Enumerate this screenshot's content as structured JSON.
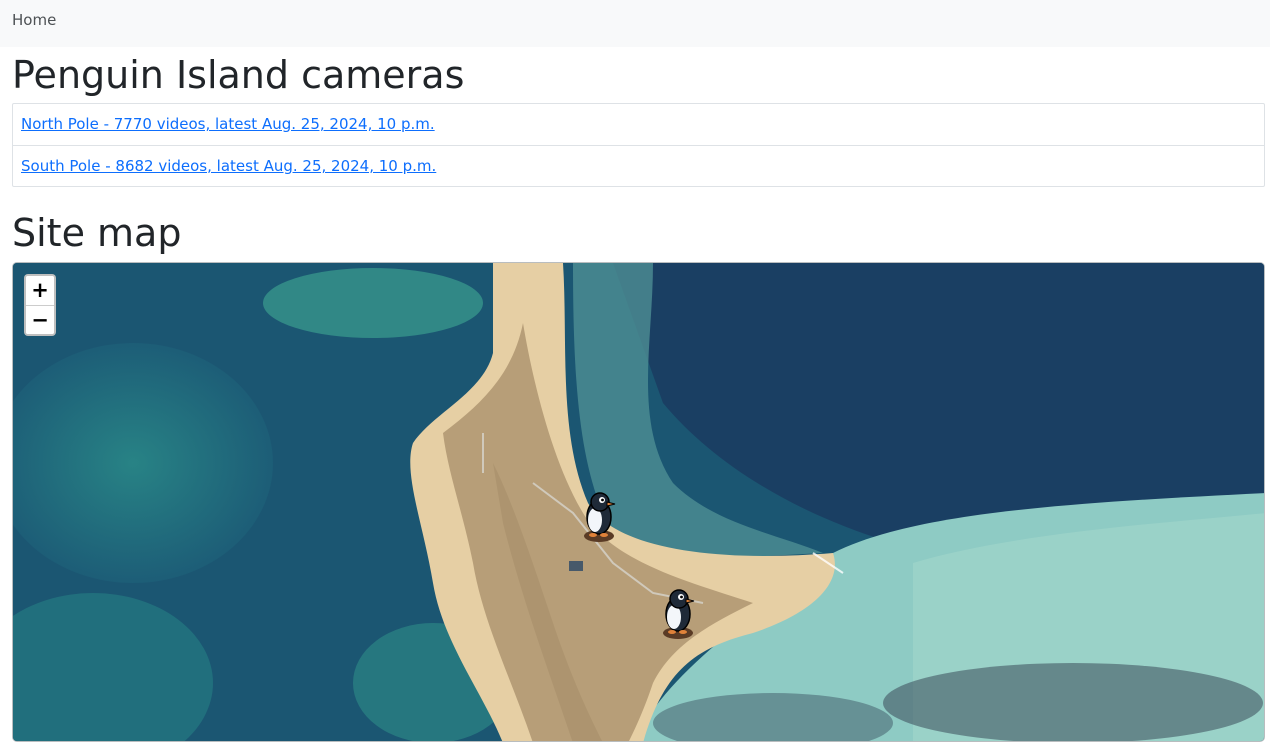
{
  "navbar": {
    "home_label": "Home"
  },
  "page": {
    "title": "Penguin Island cameras"
  },
  "cameras": [
    {
      "label": "North Pole - 7770 videos, latest Aug. 25, 2024, 10 p.m."
    },
    {
      "label": "South Pole - 8682 videos, latest Aug. 25, 2024, 10 p.m."
    }
  ],
  "site_map": {
    "title": "Site map",
    "zoom_in_label": "+",
    "zoom_out_label": "−",
    "markers": [
      {
        "camera": "North Pole",
        "icon": "penguin-icon"
      },
      {
        "camera": "South Pole",
        "icon": "penguin-icon"
      }
    ]
  },
  "colors": {
    "link": "#0d6efd",
    "navbar_bg": "#f8f9fa",
    "deep_water": "#17506e",
    "shallow_water": "#8ecbc4",
    "sand": "#e6cfa4",
    "scrub": "#b79e78"
  }
}
